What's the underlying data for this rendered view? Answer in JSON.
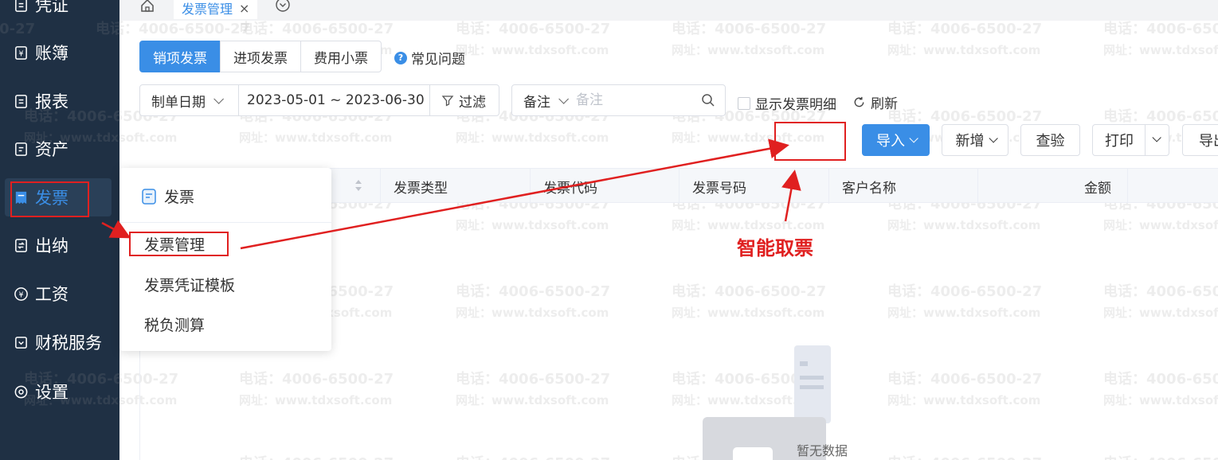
{
  "sidebar": {
    "items": [
      {
        "label": "凭证",
        "icon": "voucher-icon"
      },
      {
        "label": "账簿",
        "icon": "ledger-icon"
      },
      {
        "label": "报表",
        "icon": "report-icon"
      },
      {
        "label": "资产",
        "icon": "asset-icon"
      },
      {
        "label": "发票",
        "icon": "invoice-icon"
      },
      {
        "label": "出纳",
        "icon": "cashier-icon"
      },
      {
        "label": "工资",
        "icon": "salary-icon"
      },
      {
        "label": "财税服务",
        "icon": "tax-service-icon"
      },
      {
        "label": "设置",
        "icon": "settings-icon"
      }
    ],
    "active_index": 4
  },
  "tabbar": {
    "active_tab": "发票管理",
    "close_glyph": "×"
  },
  "invoice_types": [
    "销项发票",
    "进项发票",
    "费用小票"
  ],
  "faq_label": "常见问题",
  "filter": {
    "date_field": "制单日期",
    "date_range": "2023-05-01 ~ 2023-06-30",
    "filter_label": "过滤"
  },
  "search": {
    "field": "备注",
    "placeholder": "备注"
  },
  "show_detail_label": "显示发票明细",
  "refresh_label": "刷新",
  "toolbar": {
    "import_label": "导入",
    "add_label": "新增",
    "verify_label": "查验",
    "print_label": "打印",
    "export_label": "导出"
  },
  "table": {
    "columns": [
      "发票类型",
      "发票代码",
      "发票号码",
      "客户名称",
      "金额"
    ]
  },
  "empty_text": "暂无数据",
  "popup": {
    "title": "发票",
    "items": [
      "发票管理",
      "发票凭证模板",
      "税负测算"
    ]
  },
  "annotation": {
    "label": "智能取票"
  },
  "watermark": {
    "phone": "电话：4006-6500-27",
    "url": "网址：www.tdxsoft.com"
  },
  "colors": {
    "sidebar_bg": "#1f3044",
    "accent": "#3a8ee6",
    "annotation_red": "#e02020"
  }
}
